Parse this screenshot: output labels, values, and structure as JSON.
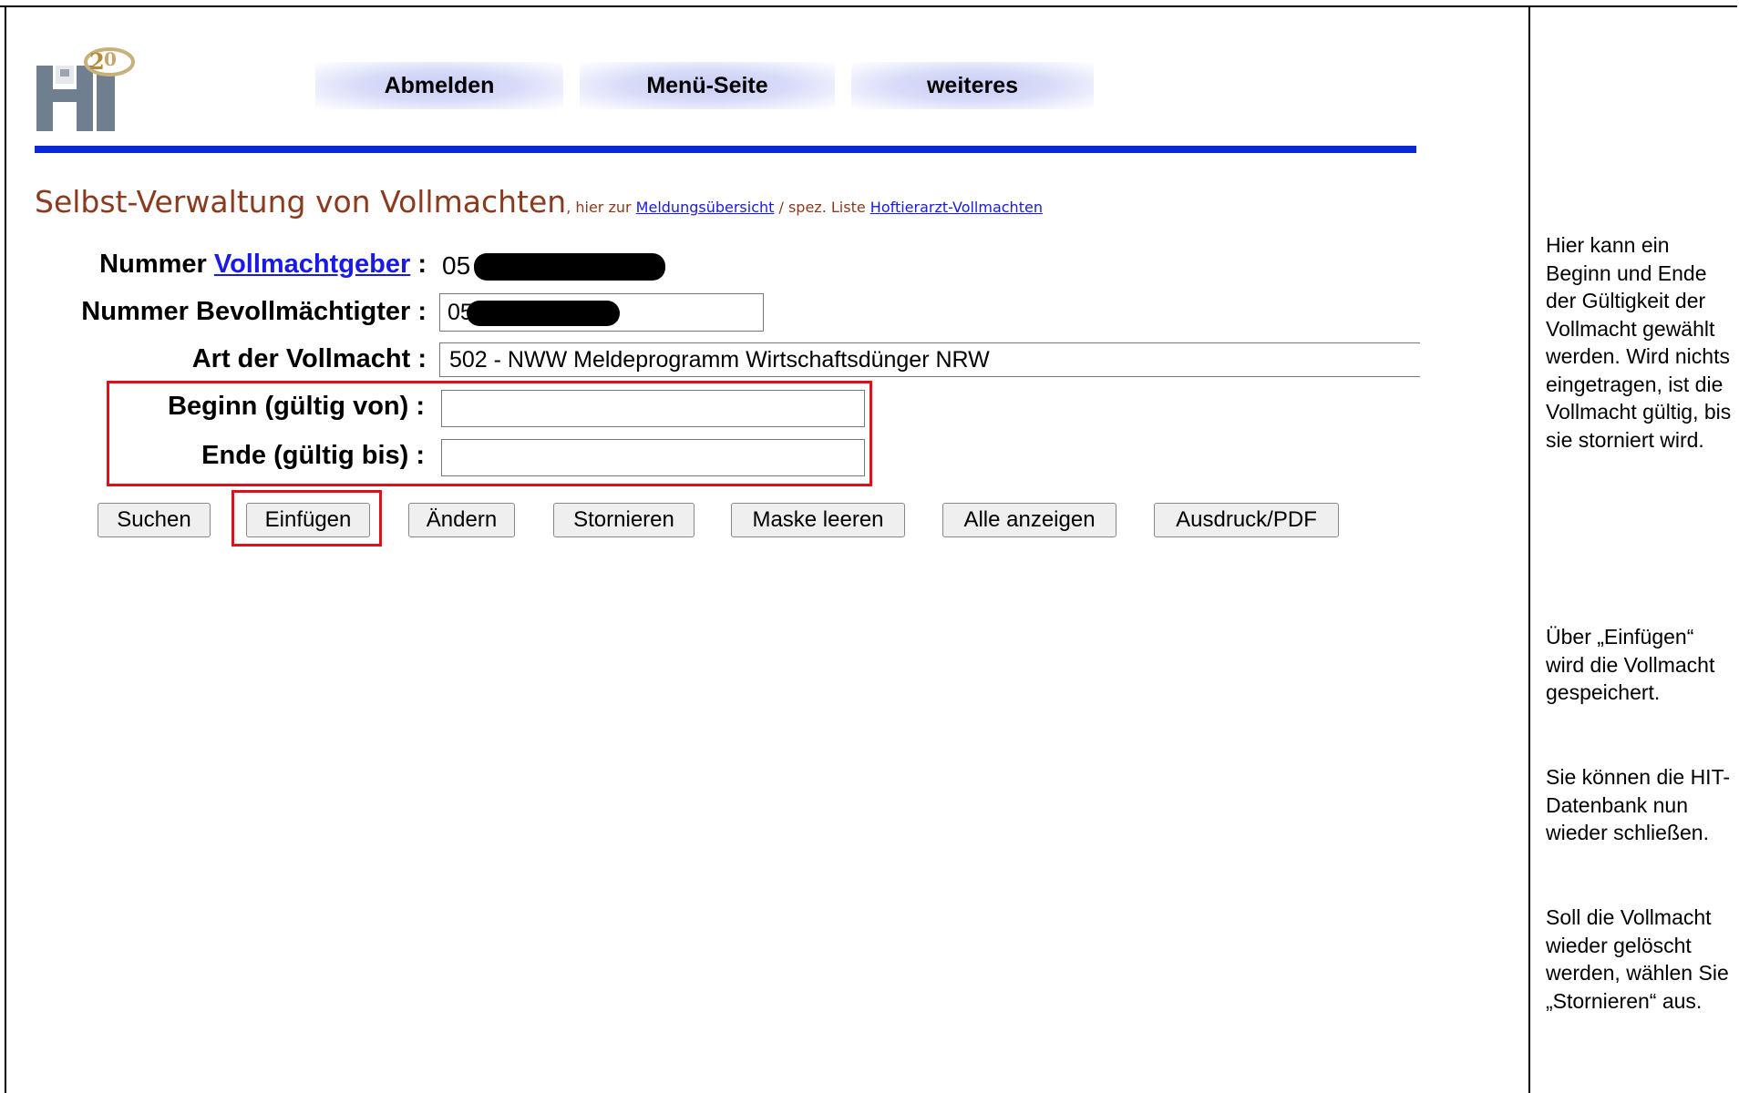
{
  "nav": {
    "logout_label": "Abmelden",
    "menu_label": "Menü-Seite",
    "more_label": "weiteres"
  },
  "heading": {
    "title": "Selbst-Verwaltung von Vollmachten",
    "sep_text": ", hier zur ",
    "overview_link": "Meldungsübersicht",
    "list_text": " / spez. Liste ",
    "vet_link": "Hoftierarzt-Vollmachten"
  },
  "form": {
    "grantor": {
      "label_prefix": "Nummer ",
      "label_link": "Vollmachtgeber",
      "label_suffix": " :",
      "value": "05"
    },
    "attorney": {
      "label": "Nummer Bevollmächtigter :",
      "value": "05"
    },
    "type": {
      "label": "Art der Vollmacht :",
      "value": "502 - NWW Meldeprogramm Wirtschaftsdünger NRW"
    },
    "start": {
      "label": "Beginn (gültig von) :",
      "value": ""
    },
    "end": {
      "label": "Ende (gültig bis) :",
      "value": ""
    }
  },
  "buttons": {
    "search": "Suchen",
    "insert": "Einfügen",
    "change": "Ändern",
    "cancel": "Stornieren",
    "clear": "Maske leeren",
    "show_all": "Alle anzeigen",
    "print": "Ausdruck/PDF"
  },
  "sidebar": {
    "note_dates": "Hier kann ein Beginn und Ende der Gültigkeit der Vollmacht gewählt werden. Wird nichts eingetragen, ist die Vollmacht gültig, bis sie storniert wird.",
    "note_insert": "Über „Einfügen“ wird die Vollmacht gespeichert.",
    "note_close": "Sie können die HIT-Datenbank nun wieder schließen.",
    "note_delete": "Soll die Vollmacht wieder gelöscht werden, wählen Sie „Stornieren“ aus."
  },
  "colors": {
    "accent_bar": "#0a28d8",
    "heading_text": "#8b3a1e",
    "highlight_box": "#e0101a",
    "link": "#1a1ae6"
  }
}
